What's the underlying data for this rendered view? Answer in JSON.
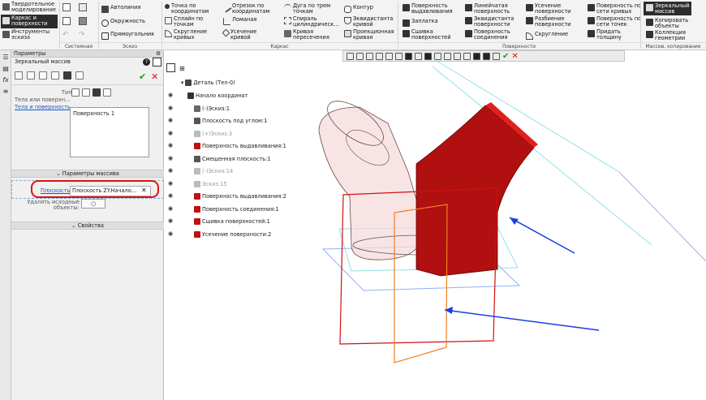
{
  "ribbon": {
    "nav": [
      {
        "label": "Твердотельное моделирование",
        "icon": "solid-icon",
        "active": false
      },
      {
        "label": "Каркас и поверхности",
        "icon": "surface-icon",
        "active": true
      },
      {
        "label": "Инструменты эскиза",
        "icon": "sketch-tools-icon",
        "active": false
      }
    ],
    "groups": {
      "system": "Системная",
      "sketch": "Эскиз",
      "frame": "Каркас",
      "surfaces": "Поверхности",
      "mirror": "Массив, копирование"
    },
    "sketch_buttons": [
      "Автолиния",
      "Окружность",
      "Прямоугольник"
    ],
    "frame_buttons": [
      "Точка по координатам",
      "Сплайн по точкам",
      "Скругление кривых",
      "Отрезок по координатам",
      "Ломаная",
      "Усечение кривой",
      "Дуга по трем точкам",
      "Спираль цилиндрическ...",
      "Кривая пересечения",
      "Контур",
      "Эквидистанта кривой",
      "Проекционная кривая"
    ],
    "surface_buttons": [
      "Поверхность выдавливания",
      "Заплатка",
      "Сшивка поверхностей",
      "Линейчатая поверхность",
      "Эквидистанта поверхности",
      "Поверхность соединения",
      "Усечение поверхности",
      "Разбиение поверхности",
      "Скругление",
      "Поверхность по сети кривых",
      "Поверхность по сети точек",
      "Придать толщину"
    ],
    "mirror_buttons": [
      "Зеркальный массив",
      "Копировать объекты",
      "Коллекция геометрии"
    ]
  },
  "panel": {
    "title": "Параметры",
    "command": "Зеркальный массив",
    "type_label": "Тип:",
    "bodies_label": "Тела или поверхн...",
    "bodies_link": "Тела и поверхность",
    "surface_item": "Поверхность 1",
    "params_section": "Параметры массива",
    "plane_link": "Плоскость",
    "plane_value": "Плоскость ZY.Начало...",
    "delete_label": "Удалять исходные объекты:",
    "props_section": "Свойства"
  },
  "tree": {
    "root": "Деталь (Тел-0)",
    "items": [
      {
        "label": "Начало координат",
        "state": "normal",
        "icon": "origin-icon"
      },
      {
        "label": "(-)Эскиз:1",
        "state": "normal",
        "icon": "sketch-icon"
      },
      {
        "label": "Плоскость под углом:1",
        "state": "normal",
        "icon": "plane-icon"
      },
      {
        "label": "(+)Эскиз:3",
        "state": "grey",
        "icon": "sketch-icon"
      },
      {
        "label": "Поверхность выдавливания:1",
        "state": "normal",
        "icon": "extrude-surface-icon"
      },
      {
        "label": "Смещенная плоскость:1",
        "state": "normal",
        "icon": "plane-icon"
      },
      {
        "label": "(-)Эскиз:14",
        "state": "grey",
        "icon": "sketch-icon"
      },
      {
        "label": "Эскиз:15",
        "state": "grey",
        "icon": "sketch-icon"
      },
      {
        "label": "Поверхность выдавливания:2",
        "state": "normal",
        "icon": "extrude-surface-icon"
      },
      {
        "label": "Поверхность соединения:1",
        "state": "normal",
        "icon": "join-surface-icon"
      },
      {
        "label": "Сшивка поверхностей:1",
        "state": "normal",
        "icon": "stitch-icon"
      },
      {
        "label": "Усечение поверхности:2",
        "state": "normal",
        "icon": "trim-surface-icon"
      }
    ]
  },
  "colors": {
    "accent_red": "#e01010",
    "model_red": "#b01010",
    "arrow_blue": "#1a3fe0",
    "plane_orange": "#f08020",
    "ok_green": "#1a9a1a"
  }
}
